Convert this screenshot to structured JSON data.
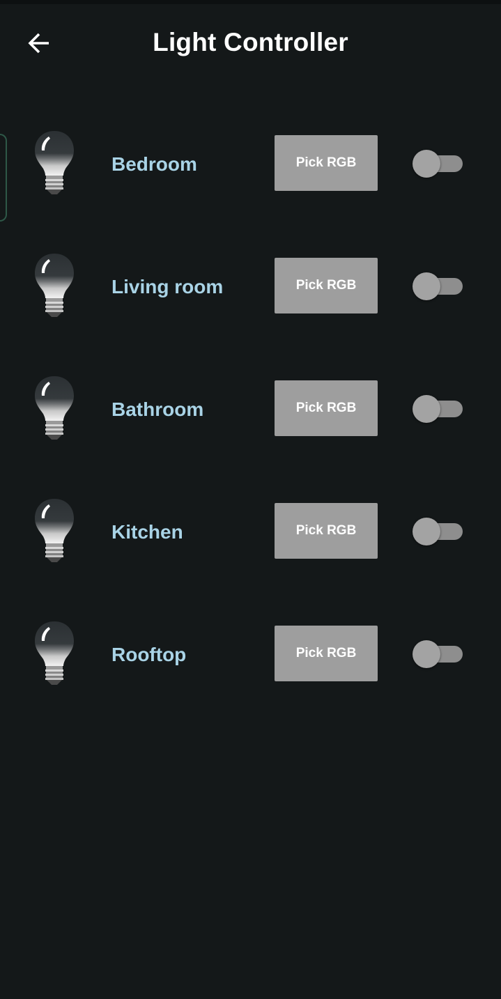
{
  "app_bar": {
    "title": "Light Controller",
    "back_icon": "arrow-left-icon"
  },
  "rooms": [
    {
      "name": "Bedroom",
      "button_label": "Pick RGB",
      "icon": "light-bulb-icon",
      "switch_on": false
    },
    {
      "name": "Living room",
      "button_label": "Pick RGB",
      "icon": "light-bulb-icon",
      "switch_on": false
    },
    {
      "name": "Bathroom",
      "button_label": "Pick RGB",
      "icon": "light-bulb-icon",
      "switch_on": false
    },
    {
      "name": "Kitchen",
      "button_label": "Pick RGB",
      "icon": "light-bulb-icon",
      "switch_on": false
    },
    {
      "name": "Rooftop",
      "button_label": "Pick RGB",
      "icon": "light-bulb-icon",
      "switch_on": false
    }
  ],
  "colors": {
    "background": "#141819",
    "room_name": "#a9d3e6",
    "button": "#9e9e9e",
    "switch_off": "#a3a3a3"
  }
}
